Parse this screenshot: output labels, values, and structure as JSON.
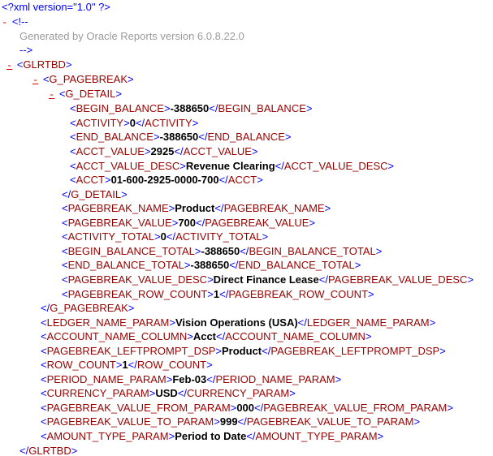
{
  "xml_decl": "<?xml version=\"1.0\" ?>",
  "toggle_minus": "-",
  "comment_open": "<!--",
  "comment_text": "Generated by Oracle Reports version 6.0.8.22.0",
  "comment_close": "-->",
  "root_tag": "GLRTBD",
  "g_pagebreak_tag": "G_PAGEBREAK",
  "g_detail_tag": "G_DETAIL",
  "begin_balance_tag": "BEGIN_BALANCE",
  "begin_balance_val": "-388650",
  "activity_tag": "ACTIVITY",
  "activity_val": "0",
  "end_balance_tag": "END_BALANCE",
  "end_balance_val": "-388650",
  "acct_value_tag": "ACCT_VALUE",
  "acct_value_val": "2925",
  "acct_value_desc_tag": "ACCT_VALUE_DESC",
  "acct_value_desc_val": "Revenue Clearing",
  "acct_tag": "ACCT",
  "acct_val": "01-600-2925-0000-700",
  "pagebreak_name_tag": "PAGEBREAK_NAME",
  "pagebreak_name_val": "Product",
  "pagebreak_value_tag": "PAGEBREAK_VALUE",
  "pagebreak_value_val": "700",
  "activity_total_tag": "ACTIVITY_TOTAL",
  "activity_total_val": "0",
  "begin_balance_total_tag": "BEGIN_BALANCE_TOTAL",
  "begin_balance_total_val": "-388650",
  "end_balance_total_tag": "END_BALANCE_TOTAL",
  "end_balance_total_val": "-388650",
  "pagebreak_value_desc_tag": "PAGEBREAK_VALUE_DESC",
  "pagebreak_value_desc_val": "Direct Finance Lease",
  "pagebreak_row_count_tag": "PAGEBREAK_ROW_COUNT",
  "pagebreak_row_count_val": "1",
  "ledger_name_param_tag": "LEDGER_NAME_PARAM",
  "ledger_name_param_val": "Vision Operations (USA)",
  "account_name_column_tag": "ACCOUNT_NAME_COLUMN",
  "account_name_column_val": "Acct",
  "pagebreak_leftprompt_dsp_tag": "PAGEBREAK_LEFTPROMPT_DSP",
  "pagebreak_leftprompt_dsp_val": "Product",
  "row_count_tag": "ROW_COUNT",
  "row_count_val": "1",
  "period_name_param_tag": "PERIOD_NAME_PARAM",
  "period_name_param_val": "Feb-03",
  "currency_param_tag": "CURRENCY_PARAM",
  "currency_param_val": "USD",
  "pagebreak_value_from_param_tag": "PAGEBREAK_VALUE_FROM_PARAM",
  "pagebreak_value_from_param_val": "000",
  "pagebreak_value_to_param_tag": "PAGEBREAK_VALUE_TO_PARAM",
  "pagebreak_value_to_param_val": "999",
  "amount_type_param_tag": "AMOUNT_TYPE_PARAM",
  "amount_type_param_val": "Period to Date"
}
